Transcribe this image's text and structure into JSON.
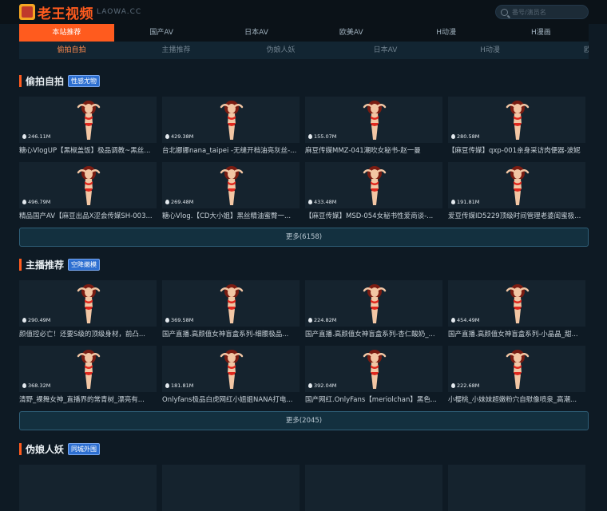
{
  "header": {
    "logo_text": "老王视频",
    "logo_domain": "LAOWA.CC",
    "search_placeholder": "番号/演员名",
    "colors": {
      "accent": "#ff5b1e",
      "tag": "#2d6fd1",
      "background": "#0e1a24"
    }
  },
  "nav_main": [
    "本站推荐",
    "国产AV",
    "日本AV",
    "欧美AV",
    "H动漫",
    "H漫画"
  ],
  "nav_sub": [
    "偷拍自拍",
    "主播推荐",
    "伪娘人妖",
    "日本AV",
    "H动漫",
    "欧美校"
  ],
  "sections": [
    {
      "title": "偷拍自拍",
      "tag": "性感尤物",
      "more": "更多(6158)",
      "cards": [
        {
          "views": "246.11M",
          "title": "糖心VlogUP【黑椒盖饭】极品调教~黑丝..."
        },
        {
          "views": "429.38M",
          "title": "台北娜娜nana_taipei -无缝开档油亮灰丝-..."
        },
        {
          "views": "155.07M",
          "title": "麻豆传媒MMZ-041潮吹女秘书-赵一曼"
        },
        {
          "views": "280.58M",
          "title": "【麻豆传媒】qxp-001亲身采访肉便器-波妮"
        },
        {
          "views": "496.79M",
          "title": "精品国产AV【麻豆出品X涩会传媒SH-003..."
        },
        {
          "views": "269.48M",
          "title": "糖心Vlog.【CD大小姐】黑丝精油蜜臀一..."
        },
        {
          "views": "433.48M",
          "title": "【麻豆传媒】MSD-054女秘书性爱商谈-..."
        },
        {
          "views": "191.81M",
          "title": "爱豆传媒ID5229顶级时间管理老婆闺蜜极..."
        }
      ]
    },
    {
      "title": "主播推荐",
      "tag": "空降嫩模",
      "more": "更多(2045)",
      "cards": [
        {
          "views": "290.49M",
          "title": "颜值控必亡！还要S级的顶级身材，前凸..."
        },
        {
          "views": "369.58M",
          "title": "国产直播.高颜值女神盲盒系列-细腰极品..."
        },
        {
          "views": "224.82M",
          "title": "国产直播.高颜值女神盲盒系列-杏仁酸奶_..."
        },
        {
          "views": "454.49M",
          "title": "国产直播.高颜值女神盲盒系列-小晶晶_甜..."
        },
        {
          "views": "368.32M",
          "title": "清野_裸舞女神_直播界的常青树_漂亮有..."
        },
        {
          "views": "181.81M",
          "title": "Onlyfans极品白虎网红小姐姐NANA打电..."
        },
        {
          "views": "392.04M",
          "title": "国产网红.OnlyFans【meriolchan】黑色..."
        },
        {
          "views": "222.68M",
          "title": "小樱桃_小妹妹超嫩粉穴自慰像喷泉_高潮..."
        }
      ]
    },
    {
      "title": "伪娘人妖",
      "tag": "同城外围"
    }
  ]
}
